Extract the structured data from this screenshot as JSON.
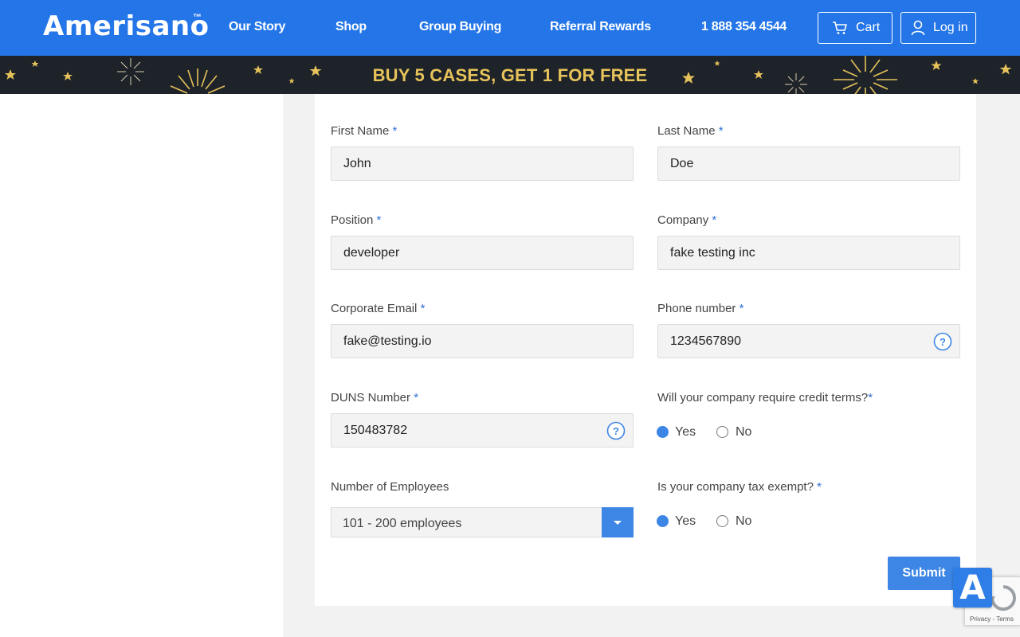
{
  "header": {
    "logo": "Amerisano",
    "logo_tm": "™",
    "nav": [
      "Our Story",
      "Shop",
      "Group Buying",
      "Referral Rewards",
      "1 888 354 4544"
    ],
    "cart_label": "Cart",
    "login_label": "Log in",
    "accent_color": "#2476e8"
  },
  "promo": {
    "text": "BUY 5 CASES, GET 1 FOR FREE",
    "text_color": "#e6c35a",
    "bg_color": "#1e2229"
  },
  "form": {
    "required_mark": "*",
    "first_name": {
      "label": "First Name",
      "value": "John"
    },
    "last_name": {
      "label": "Last Name",
      "value": "Doe"
    },
    "position": {
      "label": "Position",
      "value": "developer"
    },
    "company": {
      "label": "Company",
      "value": "fake testing inc"
    },
    "email": {
      "label": "Corporate Email",
      "value": "fake@testing.io"
    },
    "phone": {
      "label": "Phone number",
      "value": "1234567890"
    },
    "duns": {
      "label": "DUNS Number",
      "value": "150483782"
    },
    "credit_terms": {
      "label": "Will your company require credit terms?",
      "options": [
        "Yes",
        "No"
      ],
      "selected": "Yes"
    },
    "employees": {
      "label": "Number of Employees",
      "value": "101 - 200 employees"
    },
    "tax_exempt": {
      "label": "Is your company tax exempt?",
      "options": [
        "Yes",
        "No"
      ],
      "selected": "Yes"
    },
    "submit_label": "Submit"
  },
  "recaptcha": {
    "links": "Privacy - Terms"
  },
  "widget": {
    "letter": "A"
  }
}
